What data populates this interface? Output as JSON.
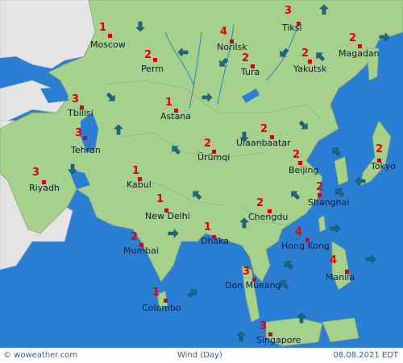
{
  "colors": {
    "land": "#a8d08d",
    "sea": "#2a7fd4",
    "other_land": "#e4e4e4",
    "city_dot": "#d6001c",
    "wind_text": "#e00000",
    "arrow": "#1a6a86"
  },
  "cities": [
    {
      "name": "Moscow",
      "wind": "1"
    },
    {
      "name": "Norilsk",
      "wind": "4"
    },
    {
      "name": "Tiksi",
      "wind": "3"
    },
    {
      "name": "Perm",
      "wind": "2"
    },
    {
      "name": "Tura",
      "wind": "2"
    },
    {
      "name": "Yakutsk",
      "wind": "2"
    },
    {
      "name": "Magadan",
      "wind": "2"
    },
    {
      "name": "Tbilisi",
      "wind": "3"
    },
    {
      "name": "Astana",
      "wind": "1"
    },
    {
      "name": "Tehran",
      "wind": "3"
    },
    {
      "name": "Ulaanbaatar",
      "wind": "2"
    },
    {
      "name": "Ürümqi",
      "wind": "2"
    },
    {
      "name": "Beijing",
      "wind": "2"
    },
    {
      "name": "Tokyo",
      "wind": "2"
    },
    {
      "name": "Riyadh",
      "wind": "3"
    },
    {
      "name": "Kabul",
      "wind": "1"
    },
    {
      "name": "Shanghai",
      "wind": "2"
    },
    {
      "name": "New Delhi",
      "wind": "1"
    },
    {
      "name": "Chengdu",
      "wind": "2"
    },
    {
      "name": "Dhaka",
      "wind": "1"
    },
    {
      "name": "Mumbai",
      "wind": "2"
    },
    {
      "name": "Hong Kong",
      "wind": "4"
    },
    {
      "name": "Manila",
      "wind": "4"
    },
    {
      "name": "Don Mueang",
      "wind": "3"
    },
    {
      "name": "Colombo",
      "wind": "1"
    },
    {
      "name": "Singapore",
      "wind": "3"
    }
  ],
  "footer": {
    "brand": "© woweather.com",
    "title": "Wind (Day)",
    "date": "08.08.2021 EDT"
  }
}
